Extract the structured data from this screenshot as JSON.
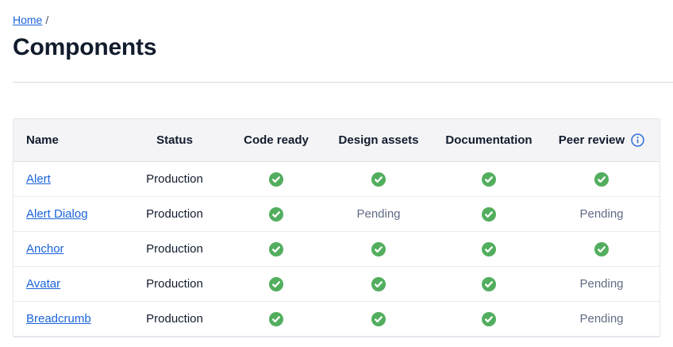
{
  "breadcrumb": {
    "home": "Home",
    "separator": "/"
  },
  "title": "Components",
  "table": {
    "columns": [
      {
        "key": "name",
        "label": "Name",
        "align": "left"
      },
      {
        "key": "status",
        "label": "Status",
        "align": "center"
      },
      {
        "key": "code_ready",
        "label": "Code ready",
        "align": "center"
      },
      {
        "key": "design_assets",
        "label": "Design assets",
        "align": "center"
      },
      {
        "key": "documentation",
        "label": "Documentation",
        "align": "center"
      },
      {
        "key": "peer_review",
        "label": "Peer review",
        "align": "center",
        "info_icon": "info-icon"
      }
    ],
    "rows": [
      {
        "name": "Alert",
        "status": "Production",
        "code_ready": "check",
        "design_assets": "check",
        "documentation": "check",
        "peer_review": "check"
      },
      {
        "name": "Alert Dialog",
        "status": "Production",
        "code_ready": "check",
        "design_assets": "pending",
        "documentation": "check",
        "peer_review": "pending"
      },
      {
        "name": "Anchor",
        "status": "Production",
        "code_ready": "check",
        "design_assets": "check",
        "documentation": "check",
        "peer_review": "check"
      },
      {
        "name": "Avatar",
        "status": "Production",
        "code_ready": "check",
        "design_assets": "check",
        "documentation": "check",
        "peer_review": "pending"
      },
      {
        "name": "Breadcrumb",
        "status": "Production",
        "code_ready": "check",
        "design_assets": "check",
        "documentation": "check",
        "peer_review": "pending"
      }
    ],
    "pending_label": "Pending"
  },
  "icons": {
    "check": "check-circle-icon",
    "info": "info-icon"
  },
  "colors": {
    "link_blue": "#1B63D9",
    "check_green": "#52AE5E",
    "pending_gray": "#606B85",
    "header_bg": "#F4F4F6",
    "text_dark": "#121C2D",
    "border": "#E4E6ED"
  }
}
